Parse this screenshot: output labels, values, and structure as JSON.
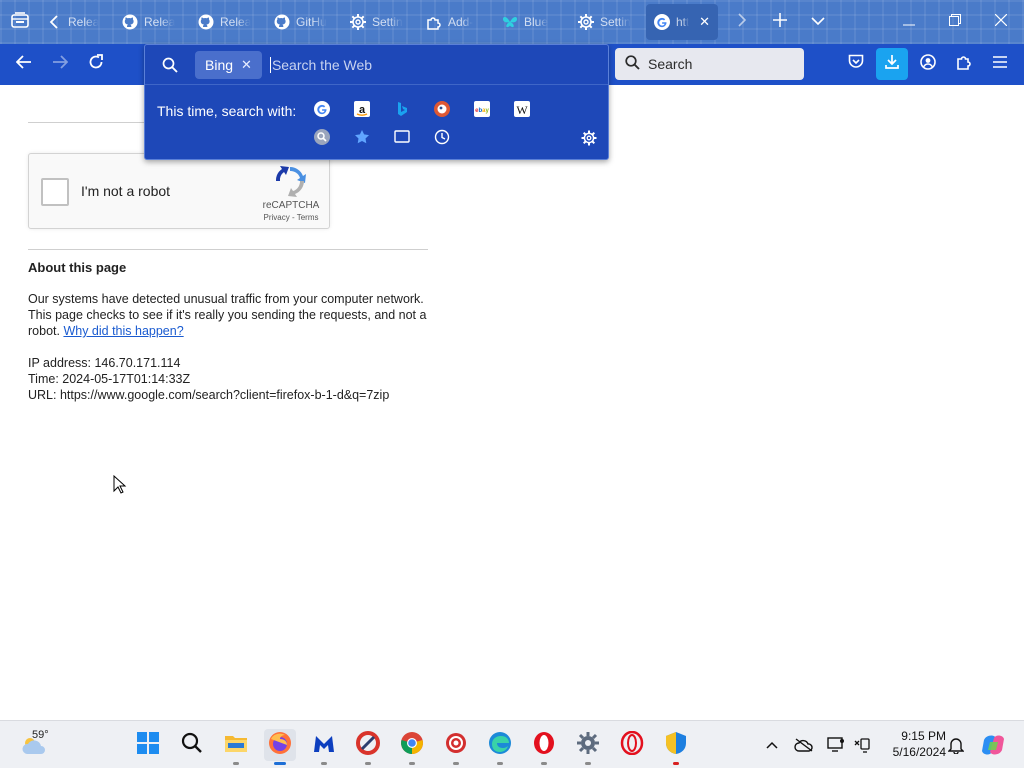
{
  "tabs": [
    {
      "label": "Relea",
      "icon": "back-chevron-icon"
    },
    {
      "label": "Relea",
      "icon": "github-icon"
    },
    {
      "label": "Relea",
      "icon": "github-icon"
    },
    {
      "label": "GitHu",
      "icon": "github-icon"
    },
    {
      "label": "Settin",
      "icon": "gear-icon"
    },
    {
      "label": "Add-",
      "icon": "puzzle-icon"
    },
    {
      "label": "Blue",
      "icon": "butterfly-icon"
    },
    {
      "label": "Settin",
      "icon": "gear-icon"
    },
    {
      "label": "htt",
      "icon": "google-icon",
      "active": true
    }
  ],
  "toolbar": {
    "search_placeholder": "Search"
  },
  "url_popup": {
    "engine_chip": "Bing",
    "input_placeholder": "Search the Web",
    "search_with_label": "This time, search with:",
    "engines": [
      "google",
      "amazon",
      "bing",
      "duckduckgo",
      "ebay",
      "wikipedia",
      "search",
      "bookmarks",
      "tabs",
      "history"
    ]
  },
  "page": {
    "captcha_label": "I'm not a robot",
    "captcha_brand": "reCAPTCHA",
    "captcha_links": "Privacy - Terms",
    "about_title": "About this page",
    "body_part1": "Our systems have detected unusual traffic from your computer network. This page checks to see if it's really you sending the requests, and not a robot.",
    "why_link": "Why did this happen?",
    "ip_line": "IP address: 146.70.171.114",
    "time_line": "Time: 2024-05-17T01:14:33Z",
    "url_line": "URL: https://www.google.com/search?client=firefox-b-1-d&q=7zip"
  },
  "taskbar": {
    "weather_temp": "59°",
    "clock_time": "9:15 PM",
    "clock_date": "5/16/2024"
  },
  "colors": {
    "tab_strip": "#4a7bc9",
    "nav_bar": "#1e50c8",
    "popup": "#1e48b8",
    "link": "#1a5bd0",
    "download_accent": "#1aa3f0"
  }
}
